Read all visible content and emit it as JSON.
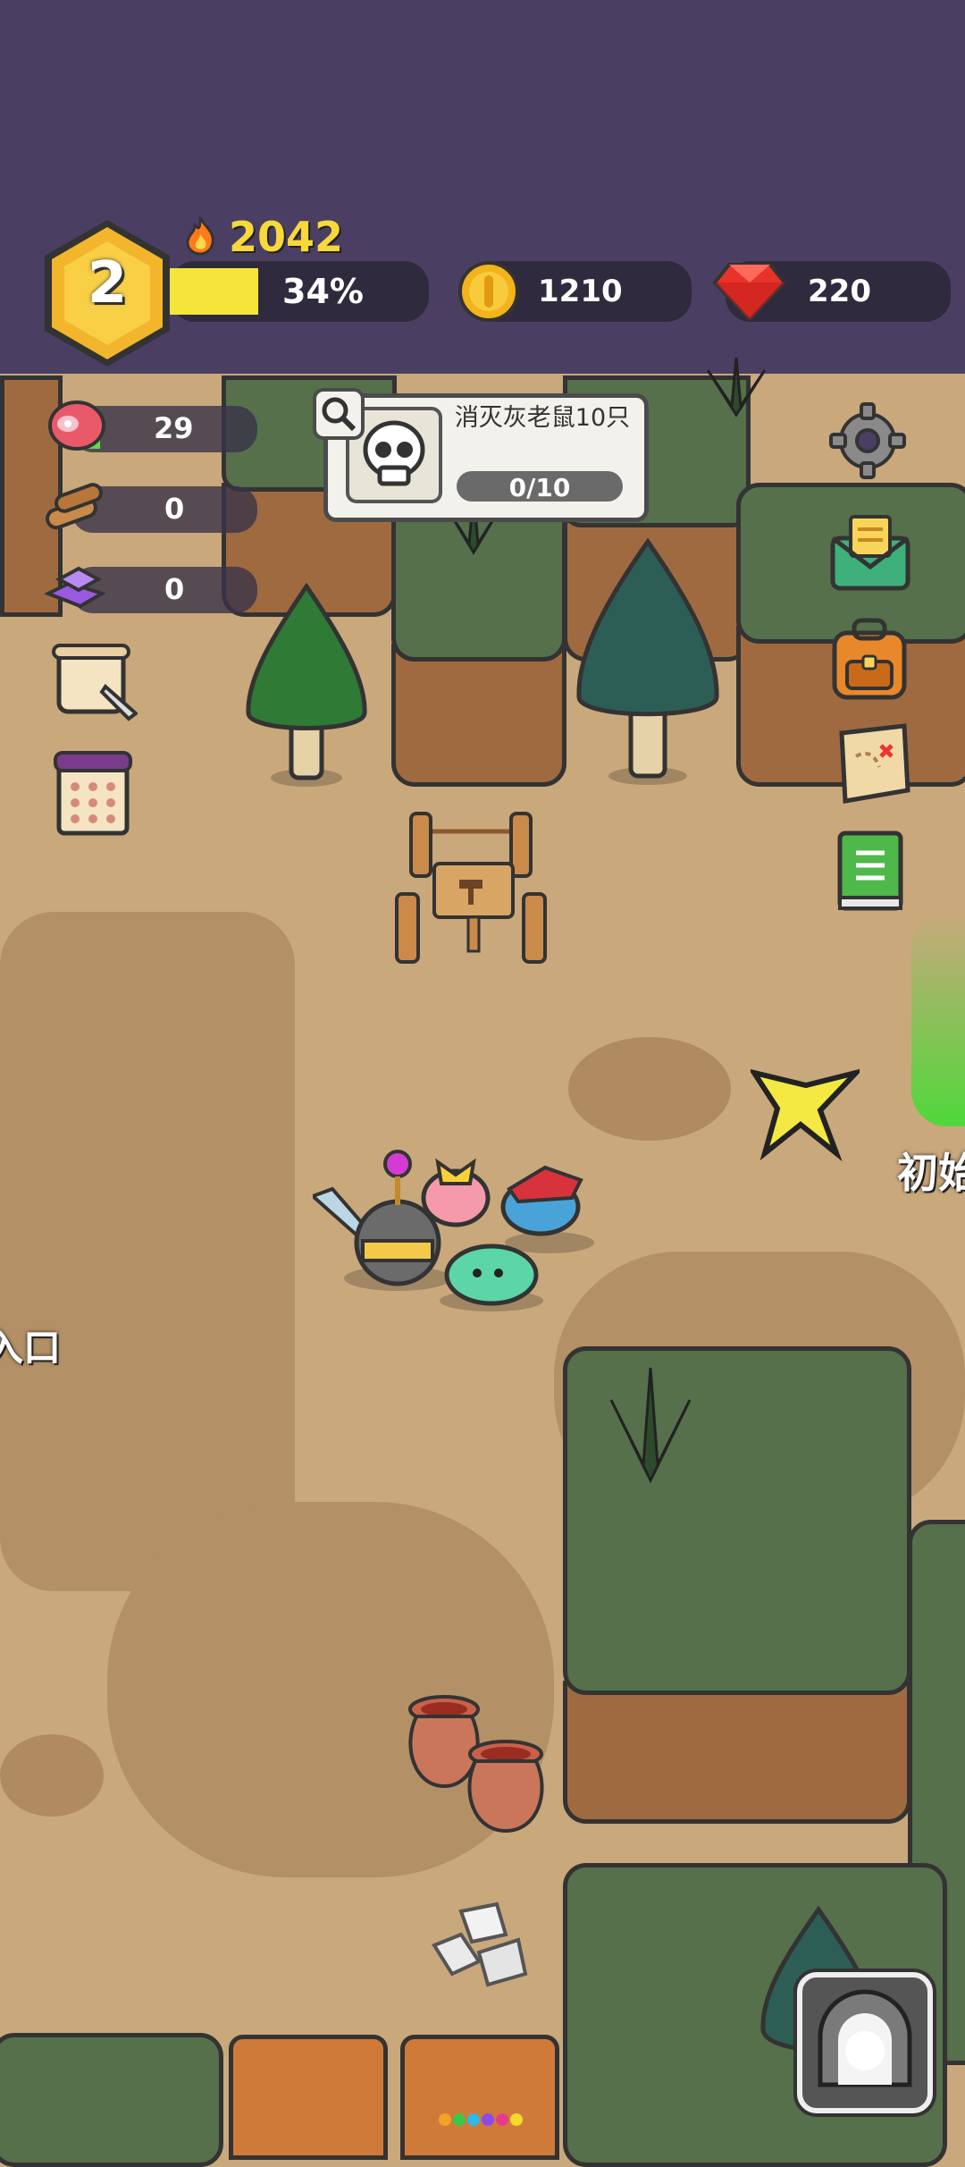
{
  "header": {
    "level": "2",
    "power": "2042",
    "xp_percent_label": "34%",
    "xp_fraction": 0.34,
    "coins": "1210",
    "gems": "220"
  },
  "resources": [
    {
      "icon": "meat-icon",
      "value": "29"
    },
    {
      "icon": "wood-icon",
      "value": "0"
    },
    {
      "icon": "crystal-ingot-icon",
      "value": "0"
    }
  ],
  "quest": {
    "title": "消灭灰老鼠10只",
    "progress": "0/10"
  },
  "map_labels": {
    "right_area_partial": "初始",
    "left_area_partial": "入口"
  },
  "colors": {
    "topbar": "#4a3f63",
    "xp_fill": "#f5e53a",
    "gem": "#e8322a",
    "coin": "#f2b31b"
  }
}
